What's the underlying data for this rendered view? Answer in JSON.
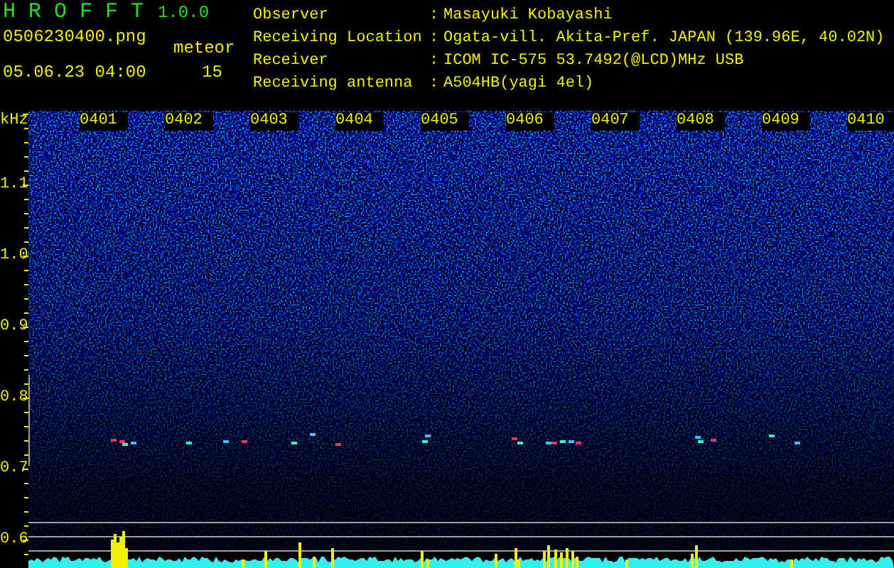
{
  "header": {
    "app_name": "H R O F F T",
    "version": "1.0.0",
    "filename": "0506230400.png",
    "datetime": "05.06.23 04:00",
    "meteor_label": "meteor",
    "meteor_count": "15"
  },
  "info": [
    {
      "label": "Observer",
      "colon": ":",
      "value": "Masayuki Kobayashi"
    },
    {
      "label": "Receiving Location",
      "colon": ":",
      "value": "Ogata-vill. Akita-Pref. JAPAN (139.96E, 40.02N)"
    },
    {
      "label": "Receiver",
      "colon": ":",
      "value": "ICOM IC-575 53.7492(@LCD)MHz USB"
    },
    {
      "label": "Receiving antenna",
      "colon": ":",
      "value": "A504HB(yagi 4el)"
    }
  ],
  "y_axis": {
    "unit": "kHz",
    "labels": [
      "1.1",
      "1.0",
      "0.9",
      "0.8",
      "0.7",
      "0.6"
    ]
  },
  "time_labels": [
    "0401",
    "0402",
    "0403",
    "0404",
    "0405",
    "0406",
    "0407",
    "0408",
    "0409",
    "0410"
  ]
}
